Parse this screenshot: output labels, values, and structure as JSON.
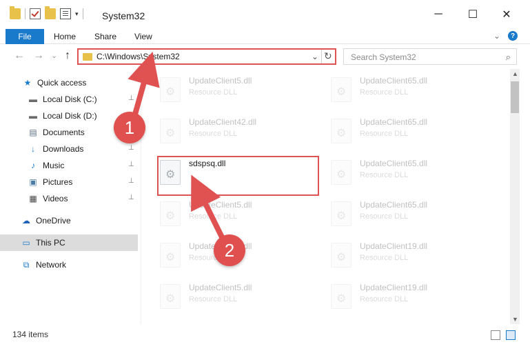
{
  "window": {
    "title": "System32",
    "controls": {
      "minimize": "─",
      "maximize": "☐",
      "close": "✕"
    }
  },
  "ribbon": {
    "tabs": [
      "File",
      "Home",
      "Share",
      "View"
    ],
    "help": "?"
  },
  "navigation": {
    "back": "←",
    "forward": "→",
    "recent": "⌄",
    "up": "↑",
    "address_path": "C:\\Windows\\System32",
    "address_dropdown": "⌄",
    "refresh": "↻",
    "search_placeholder": "Search System32",
    "search_icon": "⌕"
  },
  "sidebar": {
    "items": [
      {
        "label": "Quick access",
        "icon": "star-icon",
        "glyph": "★",
        "color": "#1979ca",
        "pinned": false
      },
      {
        "label": "Local Disk (C:)",
        "icon": "drive-icon",
        "glyph": "▬",
        "color": "#6b6b6b",
        "pinned": true
      },
      {
        "label": "Local Disk (D:)",
        "icon": "drive-icon",
        "glyph": "▬",
        "color": "#6b6b6b",
        "pinned": true
      },
      {
        "label": "Documents",
        "icon": "document-icon",
        "glyph": "▤",
        "color": "#5b6f86",
        "pinned": true
      },
      {
        "label": "Downloads",
        "icon": "download-icon",
        "glyph": "↓",
        "color": "#1979ca",
        "pinned": true
      },
      {
        "label": "Music",
        "icon": "music-icon",
        "glyph": "♪",
        "color": "#1979ca",
        "pinned": true
      },
      {
        "label": "Pictures",
        "icon": "picture-icon",
        "glyph": "▣",
        "color": "#4a7ba8",
        "pinned": true
      },
      {
        "label": "Videos",
        "icon": "video-icon",
        "glyph": "▦",
        "color": "#444",
        "pinned": true
      },
      {
        "label": "OneDrive",
        "icon": "cloud-icon",
        "glyph": "☁",
        "color": "#1e63b8",
        "pinned": false
      },
      {
        "label": "This PC",
        "icon": "monitor-icon",
        "glyph": "▭",
        "color": "#1979ca",
        "pinned": false,
        "selected": true
      },
      {
        "label": "Network",
        "icon": "network-icon",
        "glyph": "⧉",
        "color": "#1979ca",
        "pinned": false
      }
    ],
    "pin_glyph": "📌"
  },
  "files": {
    "type_label": "Resource DLL",
    "left_column": [
      "UpdateClient5.dll",
      "UpdateClient42.dll",
      "sdspsq.dll",
      "UpdateClient5.dll",
      "UpdateClient5.dll",
      "UpdateClient5.dll"
    ],
    "right_column": [
      "UpdateClient65.dll",
      "UpdateClient65.dll",
      "UpdateClient65.dll",
      "UpdateClient65.dll",
      "UpdateClient19.dll",
      "UpdateClient19.dll"
    ],
    "highlighted_file": "sdspsq.dll"
  },
  "annotations": {
    "badges": [
      "1",
      "2"
    ],
    "color": "#e05252"
  },
  "status": {
    "item_count": "134 items"
  }
}
